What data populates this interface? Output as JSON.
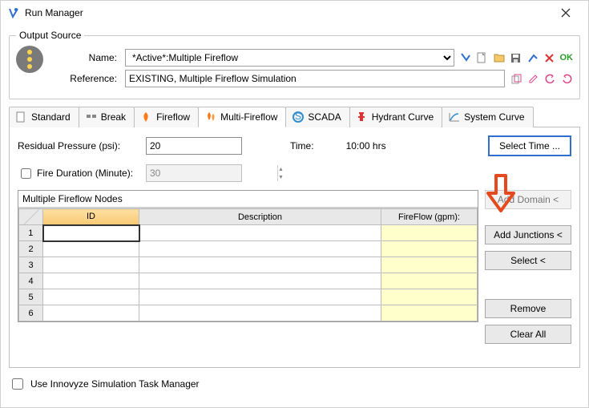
{
  "window": {
    "title": "Run Manager"
  },
  "outputSource": {
    "legend": "Output Source",
    "nameLabel": "Name:",
    "nameValue": "*Active*:Multiple Fireflow",
    "referenceLabel": "Reference:",
    "referenceValue": "EXISTING, Multiple Fireflow Simulation",
    "okText": "OK"
  },
  "tabs": [
    {
      "label": "Standard"
    },
    {
      "label": "Break"
    },
    {
      "label": "Fireflow"
    },
    {
      "label": "Multi-Fireflow"
    },
    {
      "label": "SCADA"
    },
    {
      "label": "Hydrant Curve"
    },
    {
      "label": "System Curve"
    }
  ],
  "form": {
    "residualLabel": "Residual Pressure (psi):",
    "residualValue": "20",
    "fireDurationLabel": "Fire Duration (Minute):",
    "fireDurationValue": "30",
    "timeLabel": "Time:",
    "timeValue": "10:00 hrs",
    "selectTimeBtn": "Select Time ..."
  },
  "grid": {
    "title": "Multiple Fireflow Nodes",
    "headers": {
      "id": "ID",
      "desc": "Description",
      "ff": "FireFlow (gpm):"
    },
    "rows": [
      {
        "n": "1",
        "id": "",
        "desc": "",
        "ff": ""
      },
      {
        "n": "2",
        "id": "",
        "desc": "",
        "ff": ""
      },
      {
        "n": "3",
        "id": "",
        "desc": "",
        "ff": ""
      },
      {
        "n": "4",
        "id": "",
        "desc": "",
        "ff": ""
      },
      {
        "n": "5",
        "id": "",
        "desc": "",
        "ff": ""
      },
      {
        "n": "6",
        "id": "",
        "desc": "",
        "ff": ""
      }
    ]
  },
  "buttons": {
    "addDomain": "Add Domain <",
    "addJunctions": "Add Junctions <",
    "select": "Select <",
    "remove": "Remove",
    "clearAll": "Clear All"
  },
  "footer": {
    "useTaskMgr": "Use Innovyze Simulation Task Manager"
  }
}
